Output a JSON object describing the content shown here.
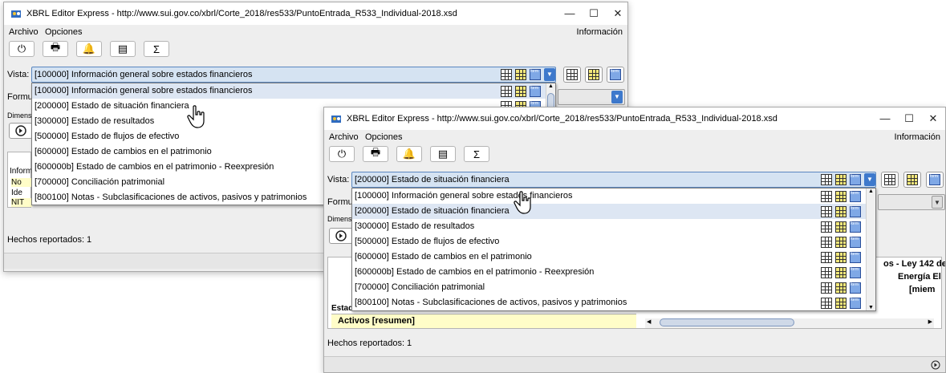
{
  "window": {
    "title": "XBRL Editor Express - http://www.sui.gov.co/xbrl/Corte_2018/res533/PuntoEntrada_R533_Individual-2018.xsd",
    "controls": {
      "minimize": "—",
      "maximize": "☐",
      "close": "✕"
    }
  },
  "menubar": {
    "items": [
      "Archivo",
      "Opciones"
    ],
    "right": "Información"
  },
  "toolbar": {
    "icons": [
      "power-icon",
      "print-icon",
      "bell-icon",
      "table-view-icon",
      "sigma-icon"
    ],
    "glyphs": [
      "⏻",
      "🖶",
      "🔔",
      "▤",
      "Σ"
    ]
  },
  "labels": {
    "vista": "Vista:",
    "formula_partial": "Formu",
    "dimensions_partial": "Dimens",
    "informe_partial": "Inform",
    "no_partial": "No",
    "ide_partial": "Ide",
    "nit_partial": "NIT",
    "estad_partial": "Estad",
    "activos": "Activos [resumen]",
    "ley_partial": "os - Ley 142 de",
    "energia_partial": "Energía El",
    "miem_partial": "[miem"
  },
  "window1": {
    "vista_selected": "[100000] Información general sobre estados financieros",
    "hechos": "Hechos reportados: 1"
  },
  "window2": {
    "vista_selected": "[200000] Estado de situación financiera",
    "hechos": "Hechos reportados: 1"
  },
  "dropdown_options": [
    "[100000] Información general sobre estados financieros",
    "[200000] Estado de situación financiera",
    "[300000] Estado de resultados",
    "[500000] Estado de flujos de efectivo",
    "[600000] Estado de cambios en el patrimonio",
    "[600000b] Estado de cambios en el patrimonio - Reexpresión",
    "[700000] Conciliación patrimonial",
    "[800100] Notas - Subclasificaciones de activos, pasivos y patrimonios"
  ],
  "colors": {
    "combo_bg": "#d5e3f2",
    "combo_border": "#5a87c0",
    "selected_item": "#dde6f3",
    "yellow_cell": "#fffdc8",
    "arrow_blue": "#3e79cc"
  }
}
